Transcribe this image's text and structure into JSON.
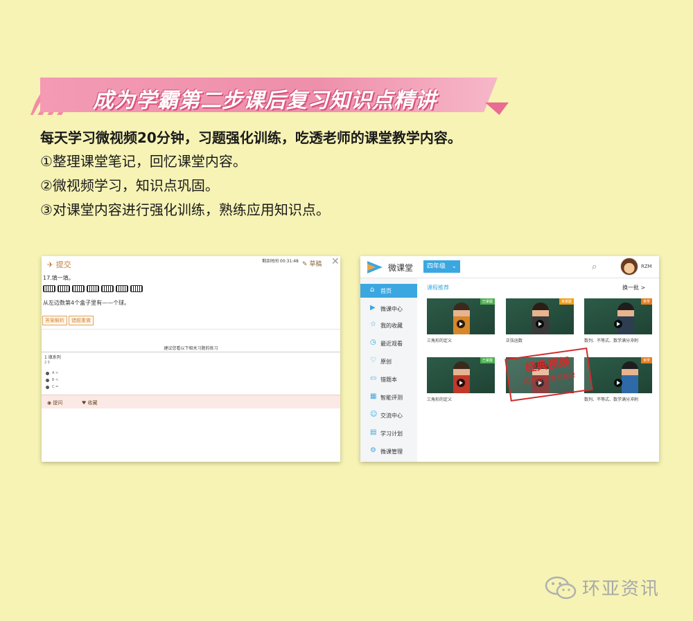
{
  "banner": {
    "title": "成为学霸第二步课后复习知识点精讲"
  },
  "intro": {
    "lead": "每天学习微视频20分钟，习题强化训练，吃透老师的课堂教学内容。",
    "items": [
      "①整理课堂笔记，回忆课堂内容。",
      "②微视频学习，知识点巩固。",
      "③对课堂内容进行强化训练，熟练应用知识点。"
    ]
  },
  "exercise": {
    "submit_label": "提交",
    "timer": "剩余时间 00:31:48",
    "draft_label": "草稿",
    "question": "17.填一填。",
    "subquestion": "从左边数第4个盒子里有——个球。",
    "answer_button": "答案解析",
    "wrong_button": "错题重做",
    "recommend": "建议您看以下相关习题的练习",
    "related_q": "1  填系列",
    "related_sub": "2  5",
    "options": [
      "A  >",
      "B  <",
      "C  ="
    ],
    "ask_label": "提问",
    "fav_label": "收藏"
  },
  "course": {
    "app_name": "微课堂",
    "grade": "四年级",
    "user": "RZM",
    "section_title": "课程推荐",
    "change_label": "换一批 >",
    "nav": [
      {
        "label": "首页",
        "icon": "home-icon",
        "glyph": "⌂"
      },
      {
        "label": "微课中心",
        "icon": "play-circle-icon",
        "glyph": "▶"
      },
      {
        "label": "我的收藏",
        "icon": "star-icon",
        "glyph": "☆"
      },
      {
        "label": "最近观看",
        "icon": "clock-icon",
        "glyph": "◷"
      },
      {
        "label": "原创",
        "icon": "heart-icon",
        "glyph": "♡"
      },
      {
        "label": "错题本",
        "icon": "document-icon",
        "glyph": "▭"
      },
      {
        "label": "智能评测",
        "icon": "chart-icon",
        "glyph": "▦"
      },
      {
        "label": "交流中心",
        "icon": "chat-icon",
        "glyph": "☺"
      },
      {
        "label": "学习计划",
        "icon": "calendar-icon",
        "glyph": "▤"
      },
      {
        "label": "微课管理",
        "icon": "gear-icon",
        "glyph": "⚙"
      }
    ],
    "videos": [
      {
        "title": "三角形的定义",
        "tag": "已掌握",
        "tag_color": "#4caf50",
        "shirt": "#d6872a"
      },
      {
        "title": "正弦函数",
        "tag": "未掌握",
        "tag_color": "#f39c12",
        "shirt": "#3a3a3a"
      },
      {
        "title": "数列、不等式、数学满分冲刺",
        "tag": "未学",
        "tag_color": "#e67e22",
        "shirt": "#2c3e50"
      },
      {
        "title": "三角形的定义",
        "tag": "已掌握",
        "tag_color": "#4caf50",
        "shirt": "#c0392b"
      },
      {
        "title": "",
        "tag": "",
        "tag_color": "#e67e22",
        "shirt": "#7a1f1f"
      },
      {
        "title": "数列、不等式、数学满分冲刺",
        "tag": "未学",
        "tag_color": "#e67e22",
        "shirt": "#2f6aa8"
      }
    ],
    "stamp": {
      "line1": "经典视频",
      "line2": "同步精讲·重点知识"
    }
  },
  "watermark": {
    "text": "环亚资讯"
  },
  "colors": {
    "page_bg": "#f6f3b5",
    "banner_pink": "#ee8fab",
    "accent_blue": "#3ba7e0",
    "stamp_red": "#d12b2b"
  }
}
